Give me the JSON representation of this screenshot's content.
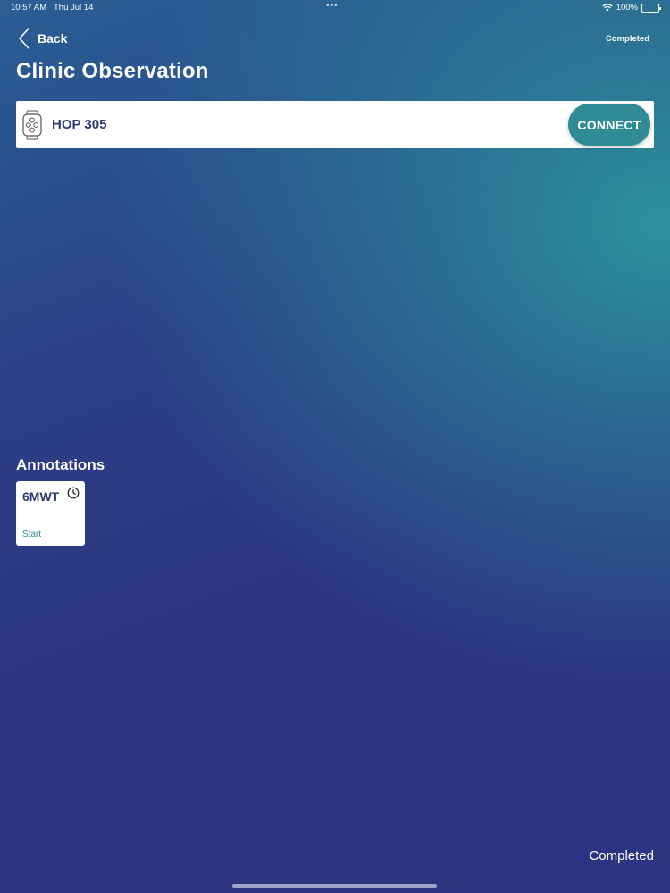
{
  "status_bar": {
    "time": "10:57 AM",
    "date": "Thu Jul 14",
    "multitask_icon": "ellipsis-icon",
    "wifi_icon": "wifi-icon",
    "battery": "100%",
    "battery_level": 1.0
  },
  "header": {
    "back_label": "Back",
    "back_icon": "chevron-left-icon",
    "status": "Completed",
    "title": "Clinic Observation"
  },
  "device": {
    "icon": "smartwatch-icon",
    "name": "HOP 305",
    "connect_label": "CONNECT"
  },
  "annotations": {
    "title": "Annotations",
    "items": [
      {
        "name": "6MWT",
        "icon": "clock-icon",
        "action": "Start"
      }
    ]
  },
  "footer": {
    "status": "Completed"
  },
  "colors": {
    "accent": "#2f8c96",
    "text_dark": "#2d3a70",
    "background_top": "#2c969e",
    "background_bottom": "#2c3380"
  }
}
